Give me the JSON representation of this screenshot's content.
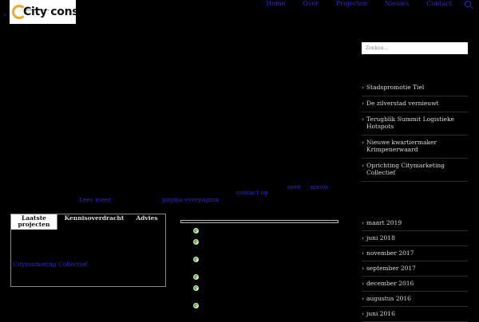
{
  "header": {
    "logo_text": "City consult",
    "nav": [
      "Home",
      "Over",
      "Projecten",
      "Nieuws",
      "Contact"
    ]
  },
  "sidebar": {
    "search_placeholder": "Zoeken...",
    "recent_posts": [
      "Stadspromotie Tiel",
      "De zilverstad vernieuwt",
      "Terugblik Summit Logistieke Hotspots",
      "Nieuwe kwartiermaker Krimpenerwaard",
      "Oprichting Citymarketing Collectief"
    ],
    "archive": [
      "maart 2019",
      "juni 2018",
      "november 2017",
      "september 2017",
      "december 2016",
      "augustus 2016",
      "juni 2016"
    ]
  },
  "links": {
    "lees_meer": "Lees meer",
    "pagina": "pagina-overpagina",
    "contact": "contact op",
    "over": "over",
    "nieuw": "nieuw"
  },
  "tabs": {
    "items": [
      "Laatste projecten",
      "Kennisoverdracht",
      "Advies"
    ],
    "active_link": "Citymarketing Collectief"
  }
}
